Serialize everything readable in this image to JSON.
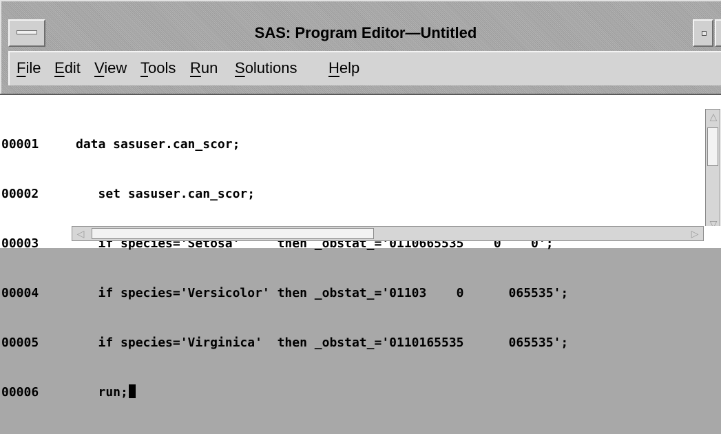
{
  "window": {
    "title": "SAS: Program Editor—Untitled"
  },
  "menu": {
    "items": [
      {
        "mnemonic": "F",
        "rest": "ile"
      },
      {
        "mnemonic": "E",
        "rest": "dit"
      },
      {
        "mnemonic": "V",
        "rest": "iew"
      },
      {
        "mnemonic": "T",
        "rest": "ools"
      },
      {
        "mnemonic": "R",
        "rest": "un"
      },
      {
        "mnemonic": "S",
        "rest": "olutions"
      },
      {
        "mnemonic": "H",
        "rest": "elp"
      }
    ]
  },
  "editor": {
    "lines": [
      {
        "number": "00001",
        "code": "data sasuser.can_scor;"
      },
      {
        "number": "00002",
        "code": "   set sasuser.can_scor;"
      },
      {
        "number": "00003",
        "code": "   if species='Setosa'     then _obstat_='0110665535    0    0';"
      },
      {
        "number": "00004",
        "code": "   if species='Versicolor' then _obstat_='01103    0      065535';"
      },
      {
        "number": "00005",
        "code": "   if species='Virginica'  then _obstat_='0110165535      065535';"
      },
      {
        "number": "00006",
        "code": "   run;"
      }
    ]
  },
  "icons": {
    "system_menu": "window-menu-icon",
    "minimize": "minimize-icon",
    "maximize": "maximize-icon",
    "scroll_up": "scroll-up-arrow-icon",
    "scroll_down": "scroll-down-arrow-icon",
    "scroll_left": "scroll-left-arrow-icon",
    "scroll_right": "scroll-right-arrow-icon"
  },
  "colors": {
    "chrome": "#d6d6d6",
    "editor_bg": "#ffffff",
    "text": "#000000"
  }
}
